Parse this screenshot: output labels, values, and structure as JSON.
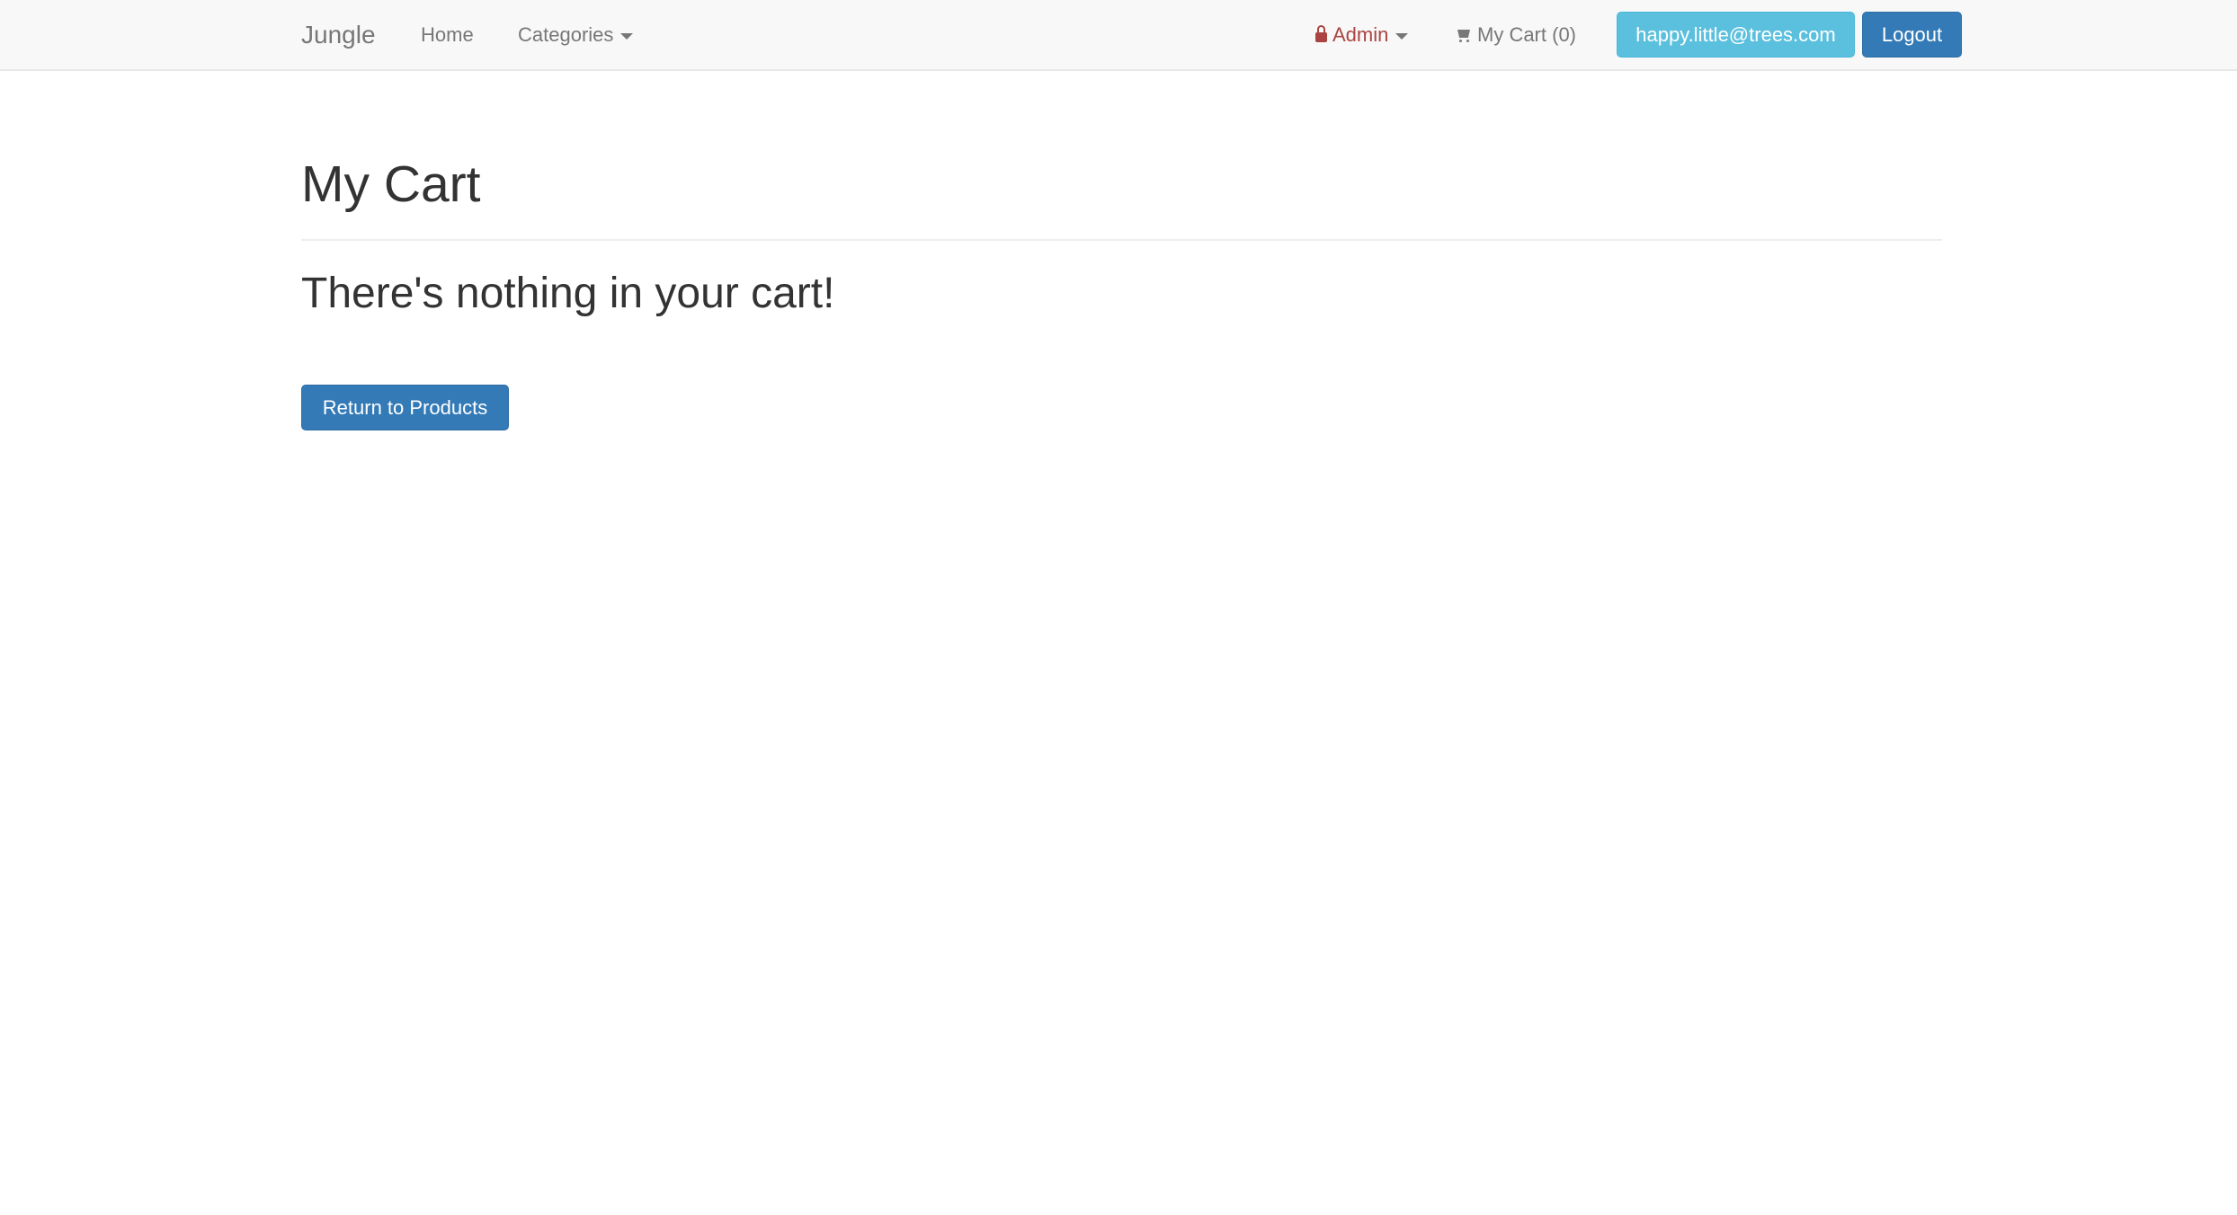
{
  "navbar": {
    "brand": "Jungle",
    "home": "Home",
    "categories": "Categories",
    "admin": "Admin",
    "cart": "My Cart (0)",
    "user_email": "happy.little@trees.com",
    "logout": "Logout"
  },
  "main": {
    "title": "My Cart",
    "empty_message": "There's nothing in your cart!",
    "return_button": "Return to Products"
  },
  "colors": {
    "primary": "#337ab7",
    "info": "#5bc0de",
    "admin": "#a94442"
  }
}
